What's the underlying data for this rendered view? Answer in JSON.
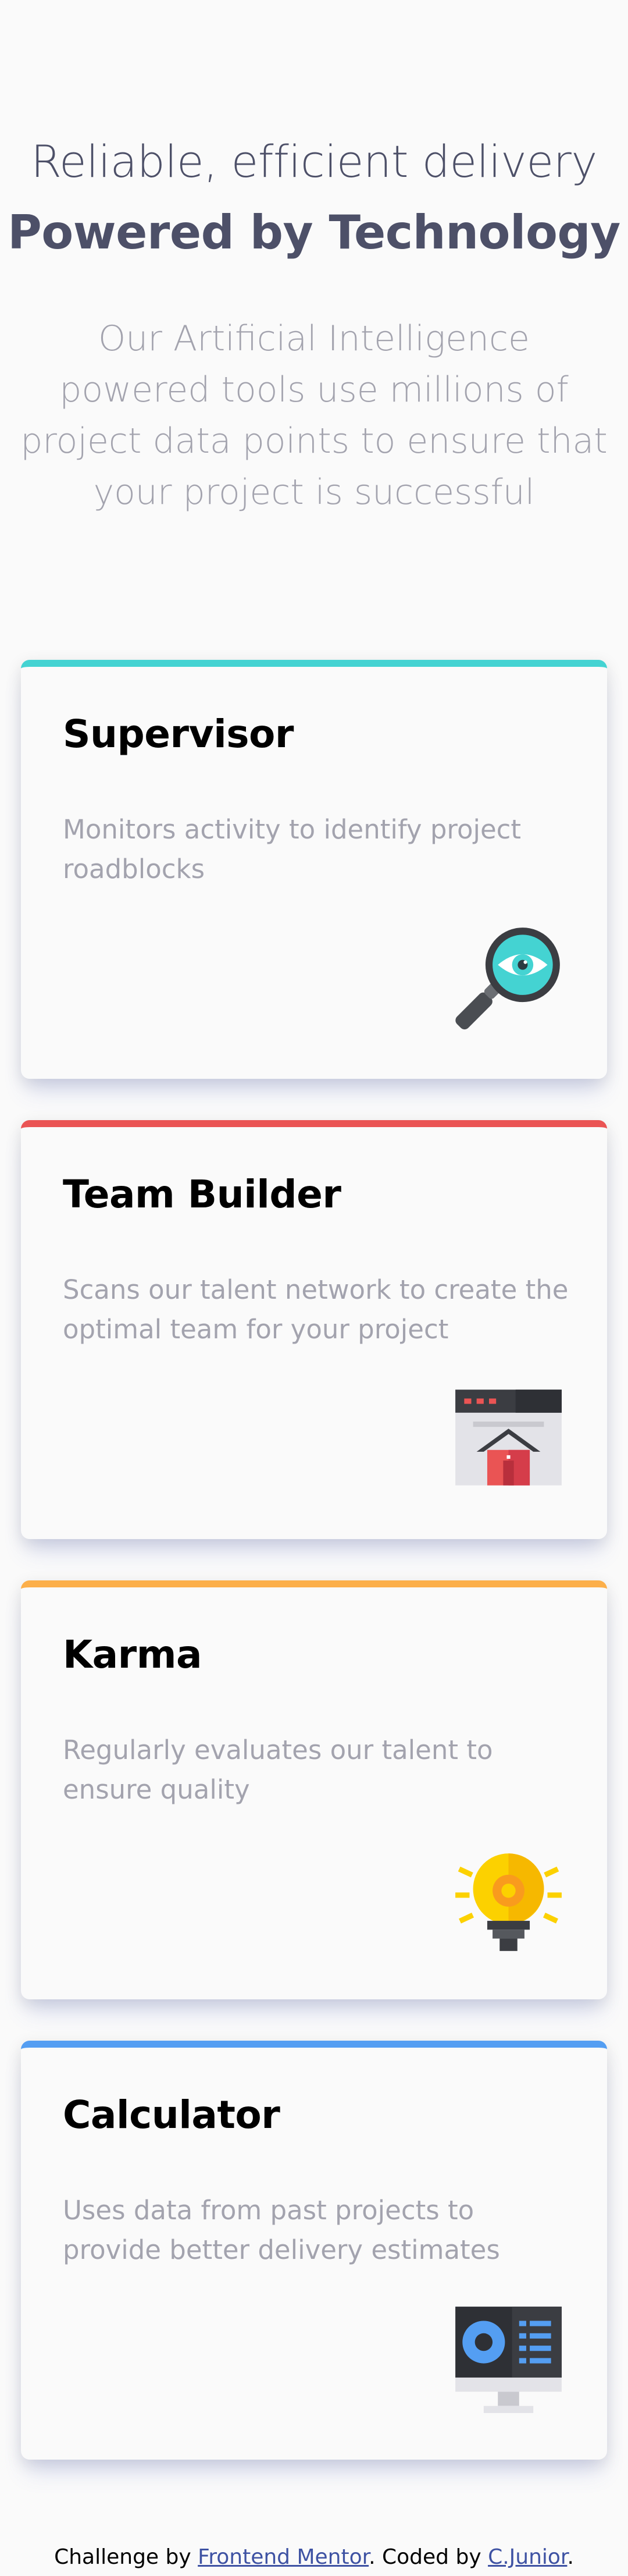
{
  "hero": {
    "line_light": "Reliable, efficient delivery",
    "line_bold": "Powered by Technology",
    "description": "Our Artificial Intelligence powered tools use millions of project data points to ensure that your project is successful"
  },
  "cards": [
    {
      "title": "Supervisor",
      "description": "Monitors activity to identify project roadblocks",
      "accent": "#44d3d2",
      "icon": "magnifier-eye-icon"
    },
    {
      "title": "Team Builder",
      "description": "Scans our talent network to create the optimal team for your project",
      "accent": "#ea5454",
      "icon": "browser-house-icon"
    },
    {
      "title": "Karma",
      "description": "Regularly evaluates our talent to ensure quality",
      "accent": "#fcaf4a",
      "icon": "lightbulb-icon"
    },
    {
      "title": "Calculator",
      "description": "Uses data from past projects to provide better delivery estimates",
      "accent": "#549ef2",
      "icon": "monitor-calculator-icon"
    }
  ],
  "footer": {
    "prefix": "Challenge by",
    "link1": "Frontend Mentor",
    "middle": ". Coded by",
    "link2": "C.Junior",
    "suffix": "."
  }
}
